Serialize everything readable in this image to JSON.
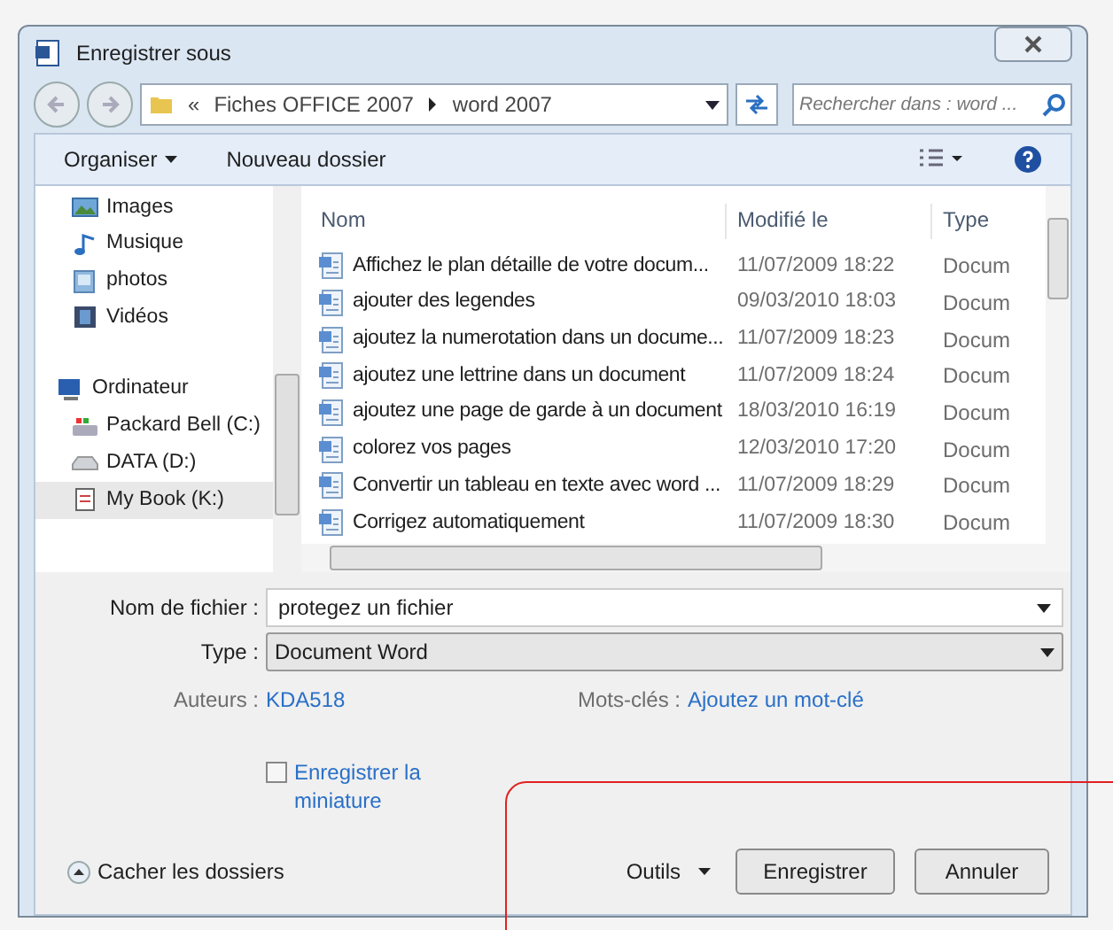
{
  "window": {
    "title": "Enregistrer sous"
  },
  "address": {
    "crumbs": [
      "«",
      "Fiches OFFICE 2007",
      "word 2007"
    ]
  },
  "search": {
    "placeholder": "Rechercher dans : word ..."
  },
  "toolbar": {
    "organize": "Organiser",
    "new_folder": "Nouveau dossier"
  },
  "sidebar": {
    "items": [
      {
        "label": "Images",
        "kind": "images",
        "selected": false
      },
      {
        "label": "Musique",
        "kind": "music",
        "selected": false
      },
      {
        "label": "photos",
        "kind": "photos",
        "selected": false
      },
      {
        "label": "Vidéos",
        "kind": "videos",
        "selected": false
      },
      {
        "label": "Ordinateur",
        "kind": "computer",
        "selected": false
      },
      {
        "label": "Packard Bell (C:)",
        "kind": "drive",
        "selected": false
      },
      {
        "label": "DATA (D:)",
        "kind": "disk",
        "selected": false
      },
      {
        "label": "My Book (K:)",
        "kind": "book",
        "selected": true
      }
    ]
  },
  "table": {
    "columns": [
      "Nom",
      "Modifié le",
      "Type"
    ],
    "rows": [
      [
        "Affichez le plan détaille de votre docum...",
        "11/07/2009 18:22",
        "Docum"
      ],
      [
        "ajouter des legendes",
        "09/03/2010 18:03",
        "Docum"
      ],
      [
        "ajoutez la numerotation dans un docume...",
        "11/07/2009 18:23",
        "Docum"
      ],
      [
        "ajoutez une lettrine dans un document",
        "11/07/2009 18:24",
        "Docum"
      ],
      [
        "ajoutez une page de garde à un document",
        "18/03/2010 16:19",
        "Docum"
      ],
      [
        "colorez vos pages",
        "12/03/2010 17:20",
        "Docum"
      ],
      [
        "Convertir un tableau en texte avec word ...",
        "11/07/2009 18:29",
        "Docum"
      ],
      [
        "Corrigez automatiquement",
        "11/07/2009 18:30",
        "Docum"
      ]
    ]
  },
  "form": {
    "filename_label": "Nom de fichier :",
    "filename": "protegez un fichier",
    "type_label": "Type :",
    "type": "Document Word",
    "authors_label": "Auteurs :",
    "authors": "KDA518",
    "keywords_label": "Mots-clés :",
    "keywords": "Ajoutez un mot-clé",
    "thumbnail": {
      "label": "Enregistrer la miniature",
      "checked": false
    }
  },
  "footer": {
    "hide_folders": "Cacher les dossiers",
    "tools": "Outils",
    "save": "Enregistrer",
    "cancel": "Annuler"
  }
}
